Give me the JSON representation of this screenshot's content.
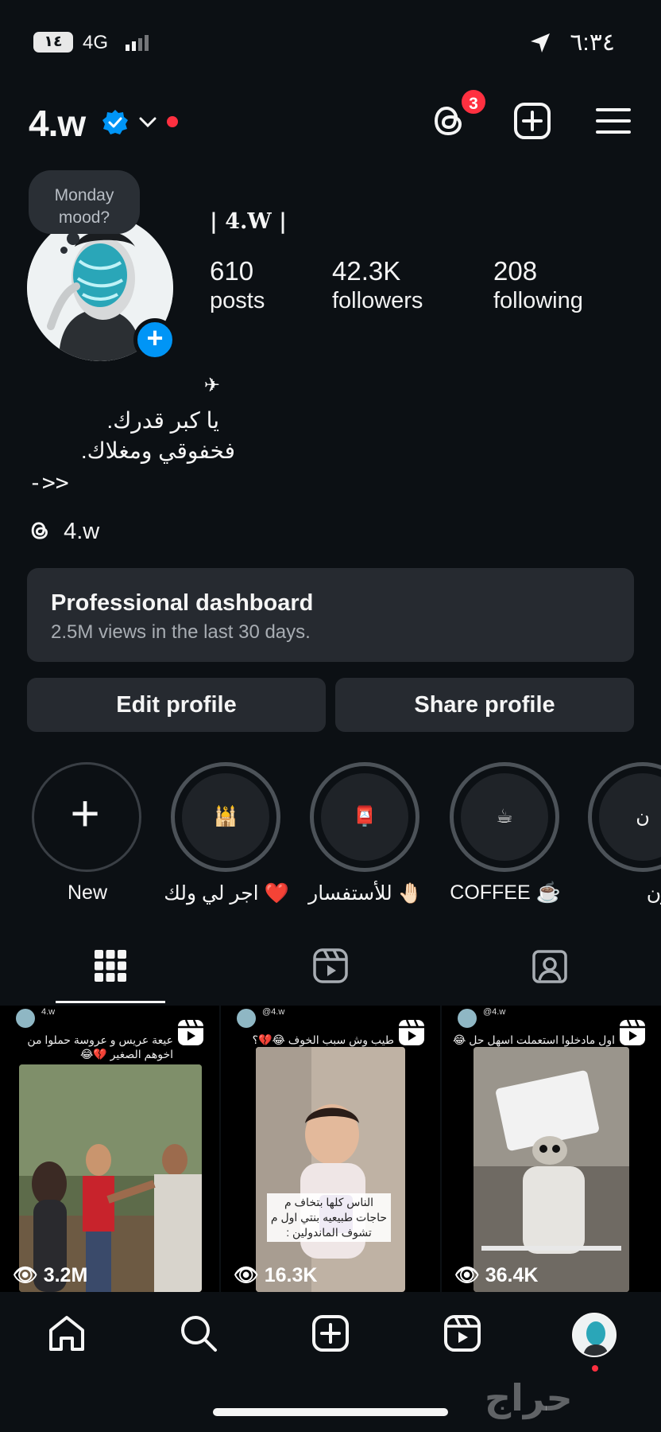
{
  "status_bar": {
    "battery": "١٤",
    "network": "4G",
    "time": "٦:٣٤"
  },
  "header": {
    "username": "4.w",
    "threads_badge": "3"
  },
  "profile": {
    "note": "Monday mood?",
    "full_name": "| 4.W |",
    "stats": [
      {
        "value": "610",
        "label": "posts"
      },
      {
        "value": "42.3K",
        "label": "followers"
      },
      {
        "value": "208",
        "label": "following"
      }
    ],
    "bio_symbol": "✈︎",
    "bio_line1": "يا كبر قدرك.",
    "bio_line2": "فخفوقي ومغلاك.",
    "bio_line3": "->>",
    "threads_handle": "4.w"
  },
  "dashboard": {
    "title": "Professional dashboard",
    "subtitle": "2.5M views in the last 30 days."
  },
  "buttons": {
    "edit": "Edit profile",
    "share": "Share profile"
  },
  "highlights": [
    {
      "label": "New",
      "emoji": "+"
    },
    {
      "label": "اجر لي ولك ❤️",
      "emoji": "🕌"
    },
    {
      "label": "للأستفسار 🤚🏻",
      "emoji": "📮"
    },
    {
      "label": "COFFEE ☕️",
      "emoji": "☕"
    },
    {
      "label": "نون ❤️",
      "emoji": "ن"
    }
  ],
  "posts": [
    {
      "handle": "4.w",
      "caption": "عيعة عريس و عروسة حملوا من اخوهم الصغير 💔😂",
      "views": "3.2M",
      "subtitle": ""
    },
    {
      "handle": "@4.w",
      "caption": "طيب وش سبب الخوف 😂💔؟",
      "views": "16.3K",
      "subtitle": "الناس كلها بتخاف م حاجات طبيعيه بنتي اول م تشوف الماندولين :"
    },
    {
      "handle": "@4.w",
      "caption": "اول مادخلوا استعملت اسهل حل 😂💔",
      "views": "36.4K",
      "subtitle": ""
    }
  ],
  "colors": {
    "background": "#0c1014",
    "card": "#262a30",
    "accent_blue": "#0095f6",
    "notification_red": "#ff3040"
  },
  "watermark": "حراج"
}
